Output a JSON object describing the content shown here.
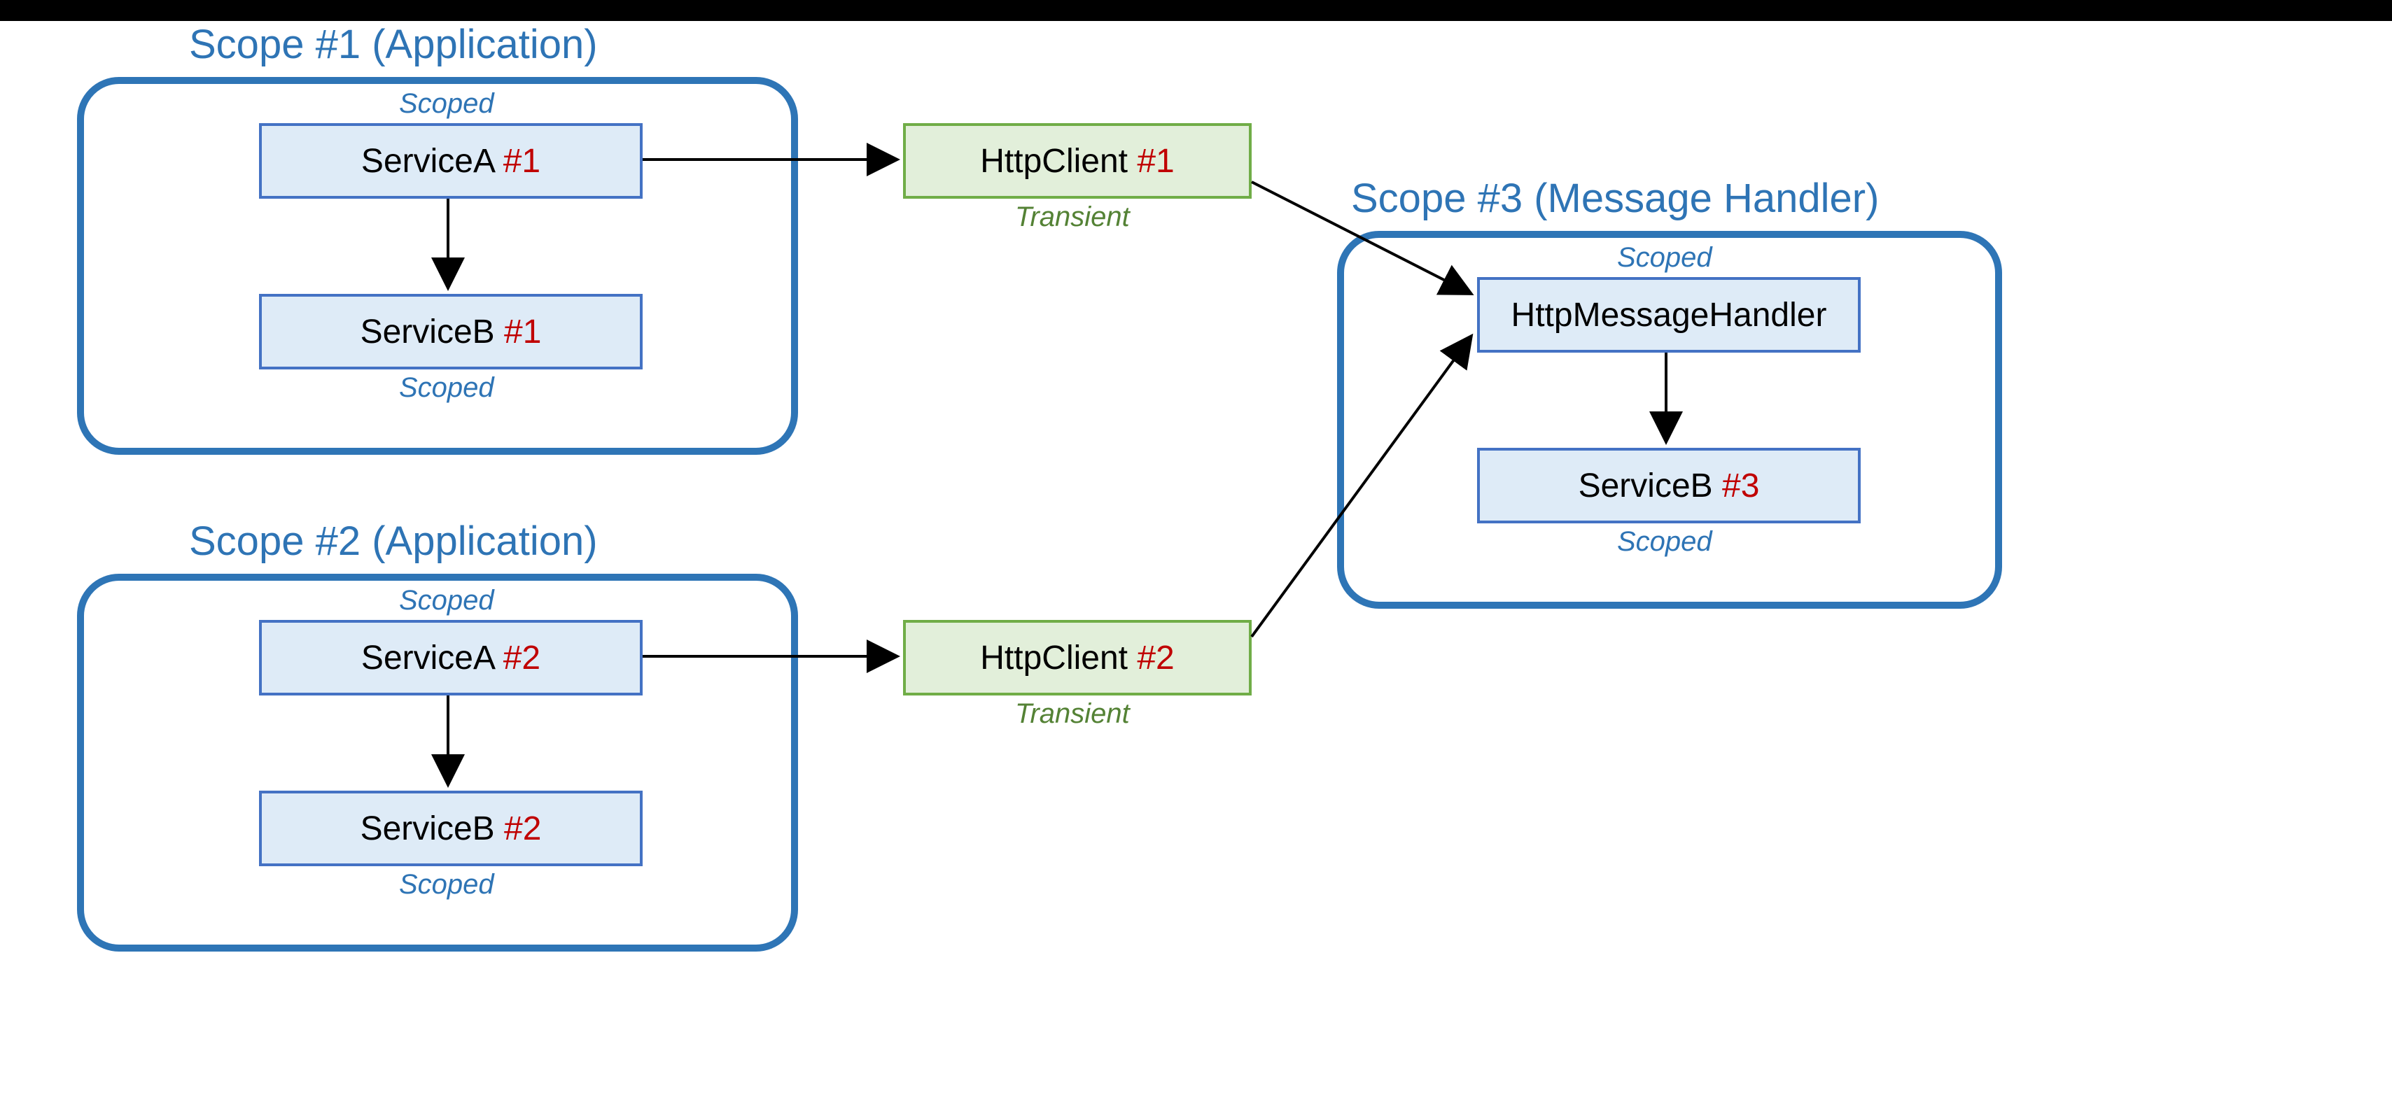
{
  "scopes": {
    "s1": {
      "title": "Scope #1 (Application)"
    },
    "s2": {
      "title": "Scope #2 (Application)"
    },
    "s3": {
      "title": "Scope #3 (Message Handler)"
    }
  },
  "lifetimes": {
    "scoped": "Scoped",
    "transient": "Transient"
  },
  "boxes": {
    "serviceA1": {
      "name": "ServiceA ",
      "tag": "#1"
    },
    "serviceB1": {
      "name": "ServiceB ",
      "tag": "#1"
    },
    "serviceA2": {
      "name": "ServiceA ",
      "tag": "#2"
    },
    "serviceB2": {
      "name": "ServiceB ",
      "tag": "#2"
    },
    "http1": {
      "name": "HttpClient ",
      "tag": "#1"
    },
    "http2": {
      "name": "HttpClient ",
      "tag": "#2"
    },
    "handler": {
      "name": "HttpMessageHandler",
      "tag": ""
    },
    "serviceB3": {
      "name": "ServiceB ",
      "tag": "#3"
    }
  },
  "colors": {
    "scopeBorder": "#2e75b6",
    "scopedText": "#2e74b5",
    "svcBorder": "#4472c4",
    "svcFill": "#deebf7",
    "httpBorder": "#70ad47",
    "httpFill": "#e2efda",
    "tag": "#c00000"
  }
}
